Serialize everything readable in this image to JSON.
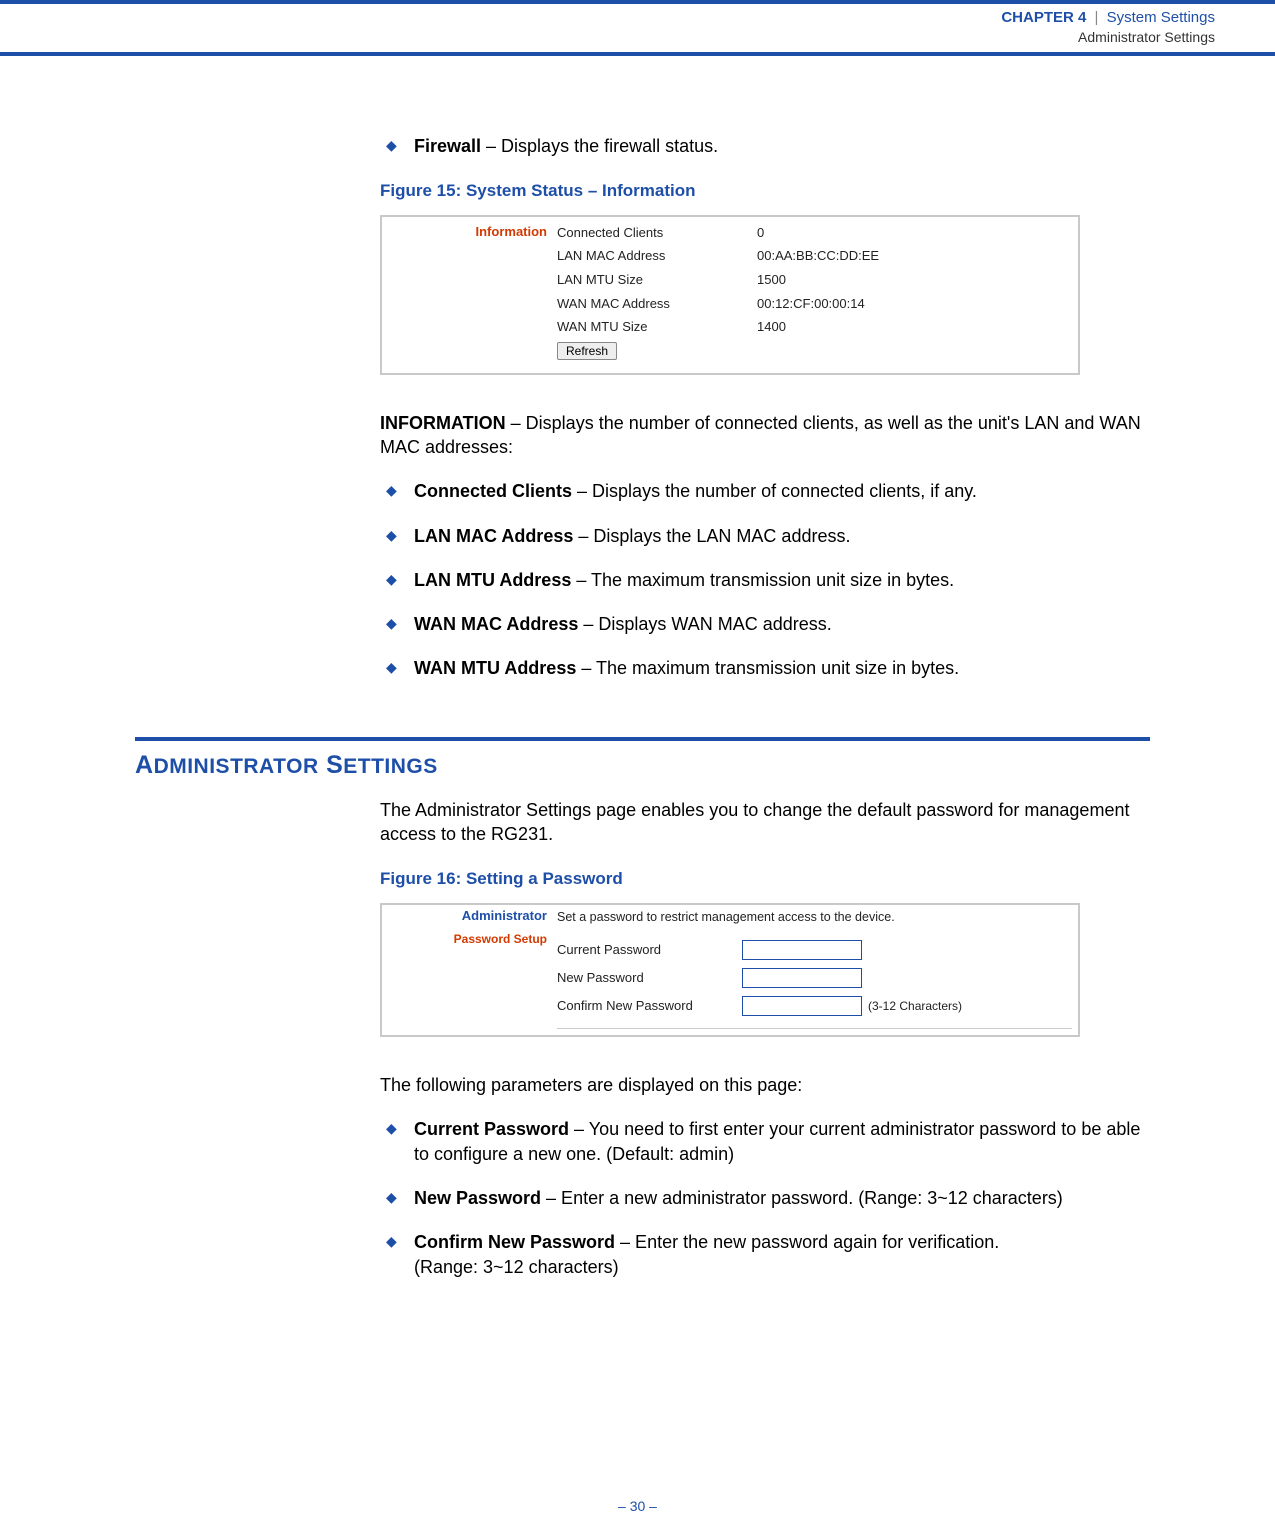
{
  "header": {
    "chapter_label": "CHAPTER 4",
    "sep": "|",
    "line1b": "System Settings",
    "line2": "Administrator Settings"
  },
  "body": {
    "firewall_term": "Firewall",
    "firewall_desc": " – Displays the firewall status.",
    "fig15_caption": "Figure 15:  System Status – Information",
    "info_panel": {
      "side_label": "Information",
      "rows": [
        {
          "k": "Connected Clients",
          "v": "0"
        },
        {
          "k": "LAN MAC Address",
          "v": "00:AA:BB:CC:DD:EE"
        },
        {
          "k": "LAN MTU Size",
          "v": "1500"
        },
        {
          "k": "WAN MAC Address",
          "v": "00:12:CF:00:00:14"
        },
        {
          "k": "WAN MTU Size",
          "v": "1400"
        }
      ],
      "refresh_btn": "Refresh"
    },
    "information_term": "INFORMATION",
    "information_desc": " – Displays the number of connected clients, as well as the unit's LAN and WAN MAC addresses:",
    "info_bullets": [
      {
        "term": "Connected Clients",
        "desc": " – Displays the number of connected clients, if any."
      },
      {
        "term": "LAN MAC Address",
        "desc": " – Displays the LAN MAC address."
      },
      {
        "term": "LAN MTU Address",
        "desc": " – The maximum transmission unit size in bytes."
      },
      {
        "term": "WAN MAC Address",
        "desc": " – Displays WAN MAC address."
      },
      {
        "term": "WAN MTU Address",
        "desc": " – The maximum transmission unit size in bytes."
      }
    ],
    "section_heading_a": "A",
    "section_heading_rest1": "DMINISTRATOR",
    "section_heading_s": " S",
    "section_heading_rest2": "ETTINGS",
    "admin_intro": "The Administrator Settings page enables you to change the default password for management access to the RG231.",
    "fig16_caption": "Figure 16:  Setting a Password",
    "admin_panel": {
      "admin_header": "Administrator",
      "pw_setup": "Password Setup",
      "hint": "Set a password to restrict management access to the device.",
      "rows": [
        {
          "label": "Current Password"
        },
        {
          "label": "New Password"
        },
        {
          "label": "Confirm New Password"
        }
      ],
      "chars_hint": "(3-12 Characters)"
    },
    "params_intro": "The following parameters are displayed on this page:",
    "param_bullets": [
      {
        "term": "Current Password",
        "desc": " – You need to first enter your current administrator password to be able to configure a new one. (Default: admin)"
      },
      {
        "term": "New Password",
        "desc": " – Enter a new administrator password. (Range: 3~12 characters)"
      },
      {
        "term": "Confirm New Password",
        "desc": " – Enter the new password again for verification.\n(Range: 3~12 characters)"
      }
    ]
  },
  "footer": {
    "page_marker": "–  30  –"
  }
}
